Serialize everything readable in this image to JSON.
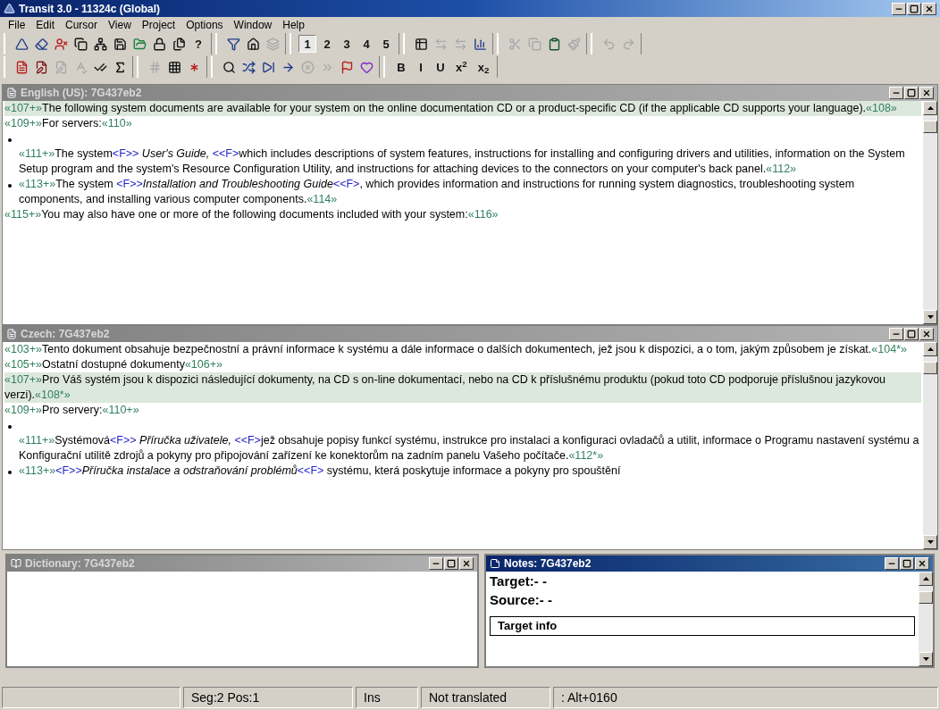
{
  "window": {
    "title": "Transit 3.0 - 11324c (Global)"
  },
  "menu": [
    {
      "label": "File"
    },
    {
      "label": "Edit"
    },
    {
      "label": "Cursor"
    },
    {
      "label": "View"
    },
    {
      "label": "Project"
    },
    {
      "label": "Options"
    },
    {
      "label": "Window"
    },
    {
      "label": "Help"
    }
  ],
  "toolbars": [
    [
      {
        "buttons": [
          {
            "kind": "icon",
            "disabled": false
          },
          {
            "kind": "icon",
            "disabled": false
          },
          {
            "kind": "icon",
            "disabled": false
          },
          {
            "kind": "icon",
            "disabled": false
          },
          {
            "kind": "icon",
            "disabled": false
          },
          {
            "kind": "icon",
            "disabled": false
          },
          {
            "kind": "icon",
            "disabled": false
          },
          {
            "kind": "icon",
            "disabled": false
          },
          {
            "kind": "icon",
            "disabled": false
          },
          {
            "kind": "text",
            "label": "?",
            "selected": false
          }
        ]
      },
      {
        "buttons": [
          {
            "kind": "icon",
            "disabled": false
          },
          {
            "kind": "icon",
            "disabled": false
          },
          {
            "kind": "icon",
            "disabled": true
          }
        ]
      },
      {
        "buttons": [
          {
            "kind": "text",
            "label": "1",
            "selected": true
          },
          {
            "kind": "text",
            "label": "2",
            "selected": false
          },
          {
            "kind": "text",
            "label": "3",
            "selected": false
          },
          {
            "kind": "text",
            "label": "4",
            "selected": false
          },
          {
            "kind": "text",
            "label": "5",
            "selected": false
          }
        ]
      },
      {
        "buttons": [
          {
            "kind": "icon",
            "disabled": false
          },
          {
            "kind": "icon",
            "disabled": true
          },
          {
            "kind": "icon",
            "disabled": true
          },
          {
            "kind": "icon",
            "disabled": false
          }
        ]
      },
      {
        "buttons": [
          {
            "kind": "icon",
            "disabled": true
          },
          {
            "kind": "icon",
            "disabled": true
          },
          {
            "kind": "icon",
            "disabled": false
          },
          {
            "kind": "icon",
            "disabled": true
          }
        ]
      },
      {
        "buttons": [
          {
            "kind": "icon",
            "disabled": true
          },
          {
            "kind": "icon",
            "disabled": true
          }
        ]
      }
    ],
    [
      {
        "buttons": [
          {
            "kind": "icon",
            "disabled": false
          },
          {
            "kind": "icon",
            "disabled": false
          },
          {
            "kind": "icon",
            "disabled": true
          },
          {
            "kind": "icon",
            "disabled": true
          },
          {
            "kind": "icon",
            "disabled": false
          },
          {
            "kind": "icon",
            "disabled": false
          }
        ]
      },
      {
        "buttons": [
          {
            "kind": "icon",
            "disabled": true
          },
          {
            "kind": "icon",
            "disabled": false
          },
          {
            "kind": "icon",
            "disabled": false
          }
        ]
      },
      {
        "buttons": [
          {
            "kind": "icon",
            "disabled": false
          },
          {
            "kind": "icon",
            "disabled": false
          },
          {
            "kind": "icon",
            "disabled": false
          },
          {
            "kind": "icon",
            "disabled": false
          },
          {
            "kind": "icon",
            "disabled": true
          },
          {
            "kind": "icon",
            "disabled": true
          },
          {
            "kind": "icon",
            "disabled": false
          },
          {
            "kind": "icon",
            "disabled": false
          }
        ]
      },
      {
        "buttons": [
          {
            "kind": "text",
            "label": "B",
            "selected": false
          },
          {
            "kind": "text",
            "label": "I",
            "selected": false
          },
          {
            "kind": "text",
            "label": "U",
            "selected": false
          },
          {
            "kind": "text",
            "label": "x$^{2}$",
            "selected": false
          },
          {
            "kind": "text",
            "label": "x$_{2}$",
            "selected": false
          }
        ]
      }
    ]
  ],
  "panes": [
    {
      "title": "English (US): 7G437eb2",
      "active": false,
      "paragraphs": [
        {
          "kind": "para",
          "selected": true,
          "gap_before": false,
          "parts": [
            {
              "kind": "tag",
              "text": "«107+»"
            },
            {
              "kind": "text",
              "text": "The following system documents are available for your system on the online documentation CD or a product-specific CD (if the applicable CD supports your language)."
            },
            {
              "kind": "tag",
              "text": "«108»"
            }
          ]
        },
        {
          "kind": "para",
          "selected": false,
          "gap_before": false,
          "parts": [
            {
              "kind": "tag",
              "text": "«109+»"
            },
            {
              "kind": "text",
              "text": "For servers:"
            },
            {
              "kind": "tag",
              "text": "«110»"
            }
          ]
        },
        {
          "kind": "bullet",
          "selected": false,
          "gap_before": true,
          "parts": [
            {
              "kind": "tag",
              "text": "«111+»"
            },
            {
              "kind": "text",
              "text": "The system"
            },
            {
              "kind": "code",
              "text": "<F>>"
            },
            {
              "kind": "italic",
              "text": " User's Guide, "
            },
            {
              "kind": "code",
              "text": "<<F>"
            },
            {
              "kind": "text",
              "text": "which includes descriptions of system features, instructions for installing and configuring drivers and utilities, information on the System Setup program and the system's Resource Configuration Utility, and instructions for attaching devices to the connectors on your computer's back panel."
            },
            {
              "kind": "tag",
              "text": "«112»"
            }
          ]
        },
        {
          "kind": "bullet",
          "selected": false,
          "gap_before": false,
          "parts": [
            {
              "kind": "tag",
              "text": "«113+»"
            },
            {
              "kind": "text",
              "text": "The system "
            },
            {
              "kind": "code",
              "text": "<F>>"
            },
            {
              "kind": "italic",
              "text": "Installation and Troubleshooting Guide"
            },
            {
              "kind": "code",
              "text": "<<F>"
            },
            {
              "kind": "text",
              "text": ", which provides information and instructions for running system diagnostics, troubleshooting system components, and installing various computer components."
            },
            {
              "kind": "tag",
              "text": "«114»"
            }
          ]
        },
        {
          "kind": "para",
          "selected": false,
          "gap_before": false,
          "parts": [
            {
              "kind": "tag",
              "text": "«115+»"
            },
            {
              "kind": "text",
              "text": "You may also have one or more of the following documents included with your system:"
            },
            {
              "kind": "tag",
              "text": "«116»"
            }
          ]
        }
      ]
    },
    {
      "title": "Czech: 7G437eb2",
      "active": false,
      "paragraphs": [
        {
          "kind": "para",
          "selected": false,
          "gap_before": false,
          "parts": [
            {
              "kind": "tag",
              "text": "«103+»"
            },
            {
              "kind": "text",
              "text": "Tento dokument obsahuje bezpečnostní a právní informace k systému a dále informace o dalších dokumentech, jež jsou k dispozici, a o tom, jakým způsobem je získat."
            },
            {
              "kind": "tag",
              "text": "«104*»"
            }
          ]
        },
        {
          "kind": "para",
          "selected": false,
          "gap_before": false,
          "parts": [
            {
              "kind": "tag",
              "text": "«105+»"
            },
            {
              "kind": "text",
              "text": "Ostatní dostupné dokumenty"
            },
            {
              "kind": "tag",
              "text": "«106+»"
            }
          ]
        },
        {
          "kind": "para",
          "selected": true,
          "gap_before": false,
          "parts": [
            {
              "kind": "tag",
              "text": "«107+»"
            },
            {
              "kind": "text",
              "text": "Pro Váš systém jsou k dispozici následující dokumenty, na CD s on-line dokumentací, nebo na CD k příslušnému produktu (pokud toto CD podporuje příslušnou jazykovou verzi)."
            },
            {
              "kind": "tag",
              "text": "«108*»"
            }
          ]
        },
        {
          "kind": "para",
          "selected": false,
          "gap_before": false,
          "parts": [
            {
              "kind": "tag",
              "text": "«109+»"
            },
            {
              "kind": "text",
              "text": "Pro servery:"
            },
            {
              "kind": "tag",
              "text": "«110+»"
            }
          ]
        },
        {
          "kind": "bullet",
          "selected": false,
          "gap_before": true,
          "parts": [
            {
              "kind": "tag",
              "text": "«111+»"
            },
            {
              "kind": "text",
              "text": "Systémová"
            },
            {
              "kind": "code",
              "text": "<F>>"
            },
            {
              "kind": "italic",
              "text": " Příručka uživatele, "
            },
            {
              "kind": "code",
              "text": "<<F>"
            },
            {
              "kind": "text",
              "text": "jež obsahuje popisy funkcí systému, instrukce pro instalaci a konfiguraci ovladačů a utilit, informace o Programu nastavení systému a Konfigurační utilitě zdrojů a pokyny pro připojování zařízení ke konektorům na zadním panelu Vašeho počítače."
            },
            {
              "kind": "tag",
              "text": "«112*»"
            }
          ]
        },
        {
          "kind": "bullet",
          "selected": false,
          "gap_before": false,
          "parts": [
            {
              "kind": "tag",
              "text": "«113+»"
            },
            {
              "kind": "code",
              "text": "<F>>"
            },
            {
              "kind": "italic",
              "text": "Příručka instalace a odstraňování problémů"
            },
            {
              "kind": "code",
              "text": "<<F>"
            },
            {
              "kind": "text",
              "text": " systému, která poskytuje informace a pokyny pro spouštění"
            }
          ]
        }
      ]
    }
  ],
  "dictionary": {
    "title": "Dictionary: 7G437eb2",
    "active": false
  },
  "notes": {
    "title": "Notes: 7G437eb2",
    "active": true,
    "lines": [
      {
        "text": "Target:- -"
      },
      {
        "text": "Source:- -"
      }
    ],
    "field": {
      "label": "Target info"
    }
  },
  "status_bar": [
    {
      "text": "Seg:2 Pos:1"
    },
    {
      "text": "Ins"
    },
    {
      "text": "Not translated"
    },
    {
      "text": ": Alt+0160"
    }
  ]
}
